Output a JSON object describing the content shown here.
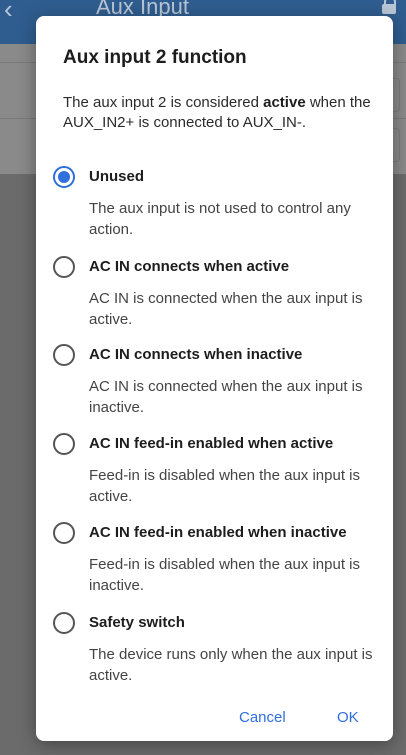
{
  "background": {
    "title": "Aux Input",
    "accent": "#2f5d8f"
  },
  "dialog": {
    "title": "Aux input 2 function",
    "desc_pre": "The aux input 2 is considered ",
    "desc_bold": "active",
    "desc_post": " when the AUX_IN2+ is connected to AUX_IN-.",
    "options": [
      {
        "label": "Unused",
        "desc": "The aux input is not used to control any action.",
        "selected": true
      },
      {
        "label": "AC IN connects when active",
        "desc": "AC IN is connected when the aux input is active.",
        "selected": false
      },
      {
        "label": "AC IN connects when inactive",
        "desc": "AC IN is connected when the aux input is inactive.",
        "selected": false
      },
      {
        "label": "AC IN feed-in enabled when active",
        "desc": "Feed-in is disabled when the aux input is active.",
        "selected": false
      },
      {
        "label": "AC IN feed-in enabled when inactive",
        "desc": "Feed-in is disabled when the aux input is inactive.",
        "selected": false
      },
      {
        "label": "Safety switch",
        "desc": "The device runs only when the aux input is active.",
        "selected": false
      }
    ],
    "cancel_label": "Cancel",
    "ok_label": "OK",
    "accent": "#2f6fde"
  }
}
